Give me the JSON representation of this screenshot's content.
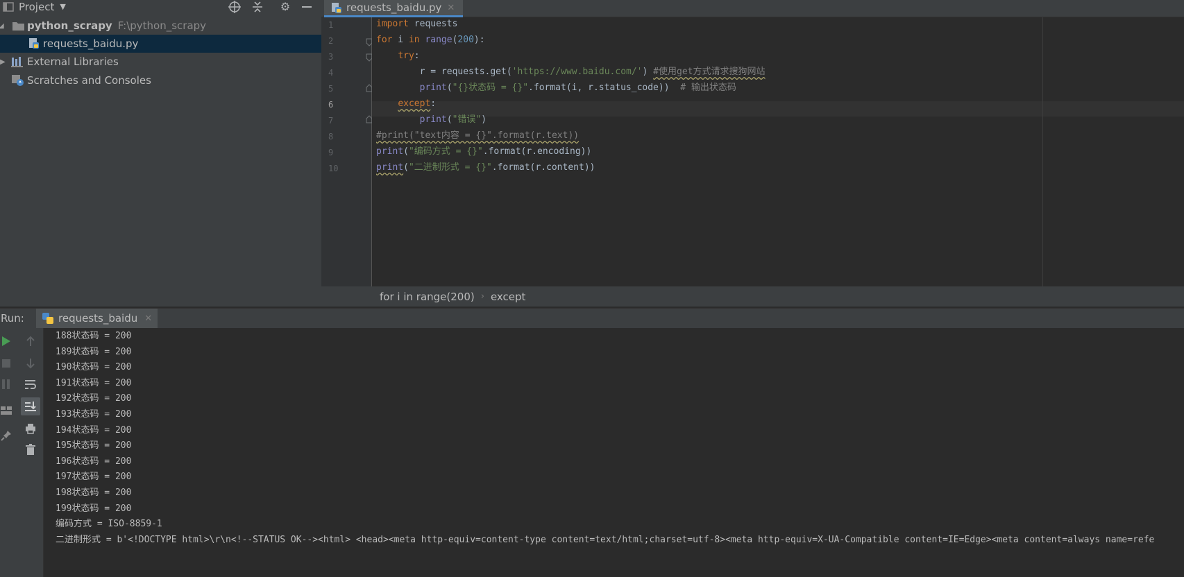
{
  "project_panel": {
    "title": "Project",
    "tree": {
      "root_name": "python_scrapy",
      "root_path": "F:\\python_scrapy",
      "file": "requests_baidu.py",
      "external_libraries": "External Libraries",
      "scratches": "Scratches and Consoles"
    }
  },
  "editor": {
    "tab_label": "requests_baidu.py",
    "line_numbers": [
      "1",
      "2",
      "3",
      "4",
      "5",
      "6",
      "7",
      "8",
      "9",
      "10"
    ],
    "current_line": 6,
    "lines": [
      {
        "segments": [
          {
            "t": "import",
            "c": "kw"
          },
          {
            "t": " requests"
          }
        ]
      },
      {
        "segments": [
          {
            "t": "for",
            "c": "kw"
          },
          {
            "t": " i "
          },
          {
            "t": "in",
            "c": "kw"
          },
          {
            "t": " "
          },
          {
            "t": "range",
            "c": "bi"
          },
          {
            "t": "("
          },
          {
            "t": "200",
            "c": "num"
          },
          {
            "t": "):"
          }
        ]
      },
      {
        "segments": [
          {
            "t": "    "
          },
          {
            "t": "try",
            "c": "kw"
          },
          {
            "t": ":"
          }
        ]
      },
      {
        "segments": [
          {
            "t": "        r = requests.get("
          },
          {
            "t": "'https://www.baidu.com/'",
            "c": "str"
          },
          {
            "t": ") "
          },
          {
            "t": "#使用get方式请求搜狗网站",
            "c": "cmt wavy"
          }
        ]
      },
      {
        "segments": [
          {
            "t": "        "
          },
          {
            "t": "print",
            "c": "bi"
          },
          {
            "t": "("
          },
          {
            "t": "\"{}状态码 = {}\"",
            "c": "str"
          },
          {
            "t": ".format(i, r.status_code))  "
          },
          {
            "t": "# 输出状态码",
            "c": "cmt"
          }
        ]
      },
      {
        "segments": [
          {
            "t": "    "
          },
          {
            "t": "except",
            "c": "kw wavy"
          },
          {
            "t": ":"
          }
        ]
      },
      {
        "segments": [
          {
            "t": "        "
          },
          {
            "t": "print",
            "c": "bi"
          },
          {
            "t": "("
          },
          {
            "t": "\"错误\"",
            "c": "str"
          },
          {
            "t": ")"
          }
        ]
      },
      {
        "segments": [
          {
            "t": "#print(\"text内容 = {}\".format(r.text))",
            "c": "cmt wavy"
          }
        ]
      },
      {
        "segments": [
          {
            "t": "print",
            "c": "bi"
          },
          {
            "t": "("
          },
          {
            "t": "\"编码方式 = {}\"",
            "c": "str"
          },
          {
            "t": ".format(r.encoding))"
          }
        ]
      },
      {
        "segments": [
          {
            "t": "print",
            "c": "bi wavy"
          },
          {
            "t": "("
          },
          {
            "t": "\"二进制形式 = {}\"",
            "c": "str"
          },
          {
            "t": ".format(r.content))"
          }
        ]
      }
    ],
    "breadcrumb": [
      "for i in range(200)",
      "except"
    ]
  },
  "run_panel": {
    "label": "Run:",
    "tab_label": "requests_baidu",
    "output": [
      "188状态码 = 200",
      "189状态码 = 200",
      "190状态码 = 200",
      "191状态码 = 200",
      "192状态码 = 200",
      "193状态码 = 200",
      "194状态码 = 200",
      "195状态码 = 200",
      "196状态码 = 200",
      "197状态码 = 200",
      "198状态码 = 200",
      "199状态码 = 200",
      "编码方式 = ISO-8859-1",
      "二进制形式 = b'<!DOCTYPE html>\\r\\n<!--STATUS OK--><html> <head><meta http-equiv=content-type content=text/html;charset=utf-8><meta http-equiv=X-UA-Compatible content=IE=Edge><meta content=always name=refe"
    ]
  },
  "colors": {
    "panel_bg": "#3c3f41",
    "editor_bg": "#2b2b2b",
    "keyword": "#cc7832",
    "string": "#6a8759",
    "number": "#6897bb",
    "builtin": "#8888c6",
    "comment": "#808080",
    "selection": "#0d293e"
  }
}
